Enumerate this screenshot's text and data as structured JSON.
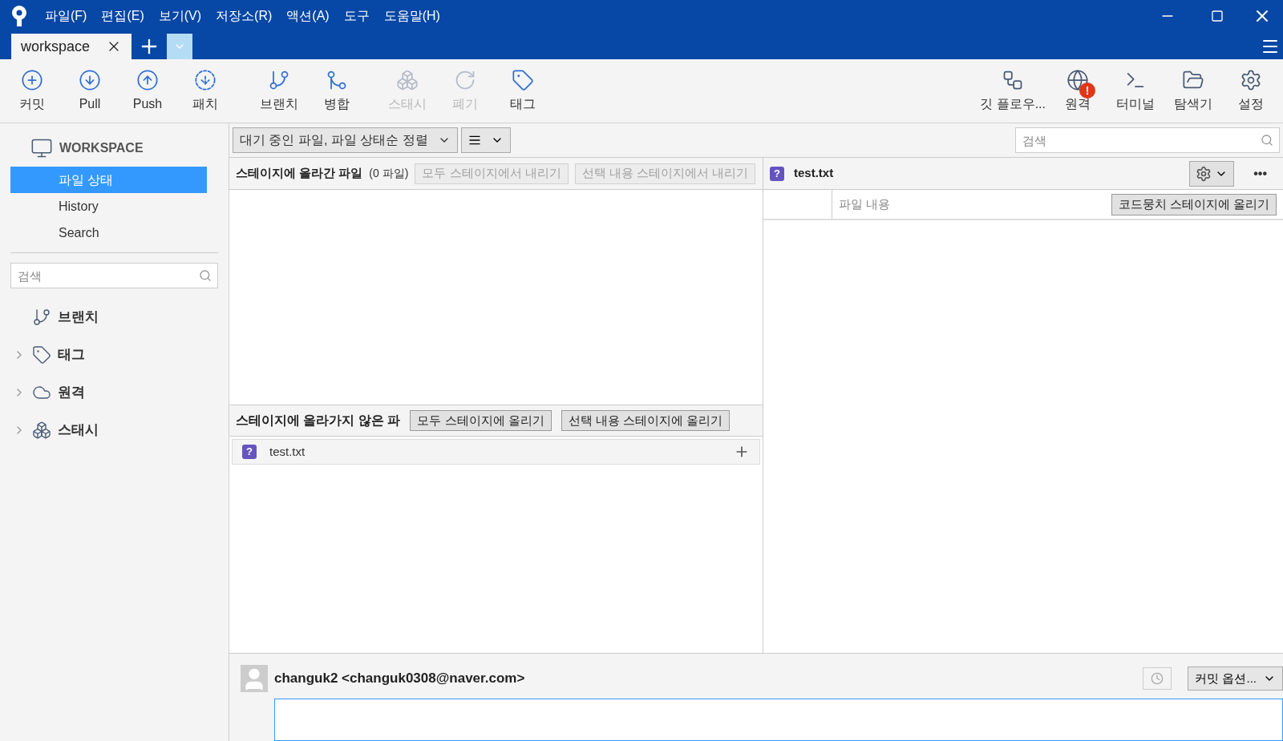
{
  "menu": [
    "파일(F)",
    "편집(E)",
    "보기(V)",
    "저장소(R)",
    "액션(A)",
    "도구",
    "도움말(H)"
  ],
  "tabs": [
    {
      "label": "workspace",
      "selected": true
    }
  ],
  "toolbar_left": [
    {
      "kind": "commit",
      "label": "커밋",
      "disabled": false
    },
    {
      "kind": "pull",
      "label": "Pull",
      "disabled": false
    },
    {
      "kind": "push",
      "label": "Push",
      "disabled": false
    },
    {
      "kind": "fetch",
      "label": "패치",
      "disabled": false
    },
    {
      "kind": "branch",
      "label": "브랜치",
      "disabled": false
    },
    {
      "kind": "merge",
      "label": "병합",
      "disabled": false
    },
    {
      "kind": "stash",
      "label": "스태시",
      "disabled": true
    },
    {
      "kind": "discard",
      "label": "폐기",
      "disabled": true
    },
    {
      "kind": "tag",
      "label": "태그",
      "disabled": false
    }
  ],
  "toolbar_right": [
    {
      "kind": "flow",
      "label": "깃 플로우...",
      "disabled": false
    },
    {
      "kind": "remote",
      "label": "원격",
      "disabled": false,
      "badge": "!"
    },
    {
      "kind": "terminal",
      "label": "터미널",
      "disabled": false
    },
    {
      "kind": "explorer",
      "label": "탐색기",
      "disabled": false
    },
    {
      "kind": "settings",
      "label": "설정",
      "disabled": false
    }
  ],
  "sidebar": {
    "workspace": "WORKSPACE",
    "items": [
      {
        "label": "파일 상태",
        "selected": true
      },
      {
        "label": "History",
        "selected": false
      },
      {
        "label": "Search",
        "selected": false
      }
    ],
    "search": {
      "placeholder": "검색"
    },
    "groups": [
      {
        "kind": "branch",
        "label": "브랜치",
        "has_children": false
      },
      {
        "kind": "tag",
        "label": "태그",
        "has_children": true
      },
      {
        "kind": "remote",
        "label": "원격",
        "has_children": true
      },
      {
        "kind": "stash",
        "label": "스태시",
        "has_children": true
      }
    ]
  },
  "filter": {
    "sort": "대기 중인 파일, 파일 상태순 정렬",
    "search_placeholder": "검색"
  },
  "staged": {
    "title": "스테이지에 올라간 파일",
    "count": "(0 파일)",
    "buttons": [
      {
        "label": "모두 스테이지에서 내리기",
        "disabled": true
      },
      {
        "label": "선택 내용 스테이지에서 내리기",
        "disabled": true
      }
    ]
  },
  "unstaged": {
    "title": "스테이지에 올라가지 않은 파",
    "buttons": [
      {
        "label": "모두 스테이지에 올리기",
        "disabled": false
      },
      {
        "label": "선택 내용 스테이지에 올리기",
        "disabled": false
      }
    ],
    "files": [
      {
        "name": "test.txt",
        "status": "?"
      }
    ]
  },
  "diff": {
    "file": "test.txt",
    "status": "?",
    "column": "파일 내용",
    "hunk_button": "코드뭉치 스테이지에 올리기",
    "more": "•••"
  },
  "commit": {
    "author": "changuk2 <changuk0308@naver.com>",
    "options": "커밋 옵션..."
  }
}
